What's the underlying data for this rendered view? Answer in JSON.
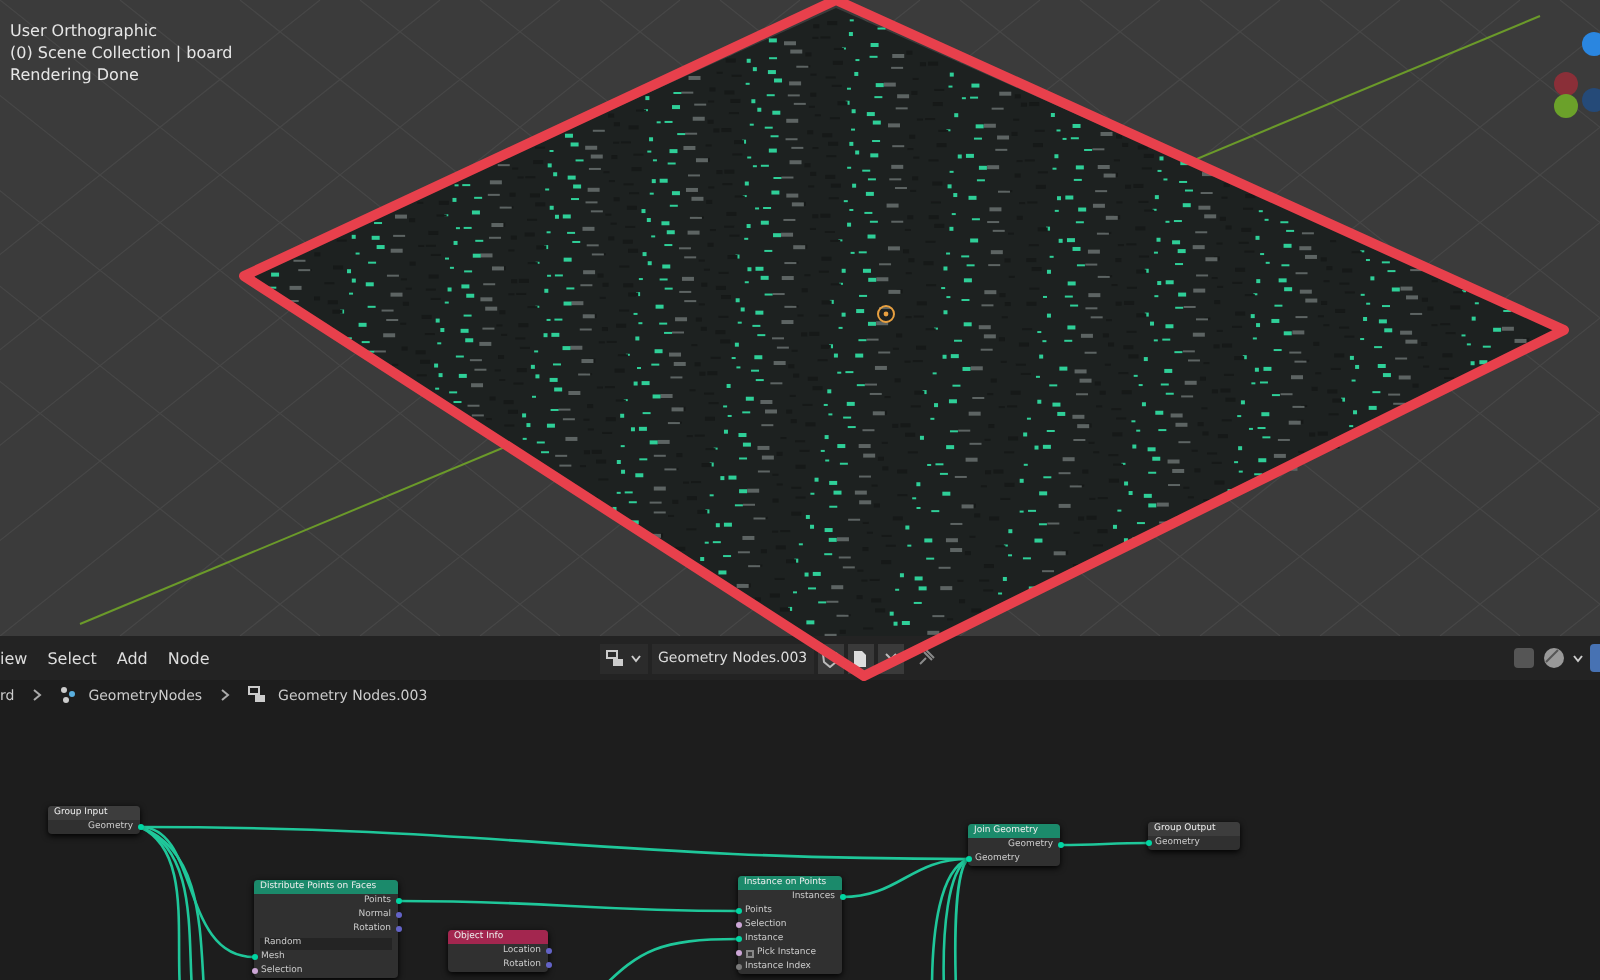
{
  "viewport": {
    "view_name": "User Orthographic",
    "collection": "(0) Scene Collection | board",
    "status": "Rendering Done"
  },
  "node_editor": {
    "menu": [
      "iew",
      "Select",
      "Add",
      "Node"
    ],
    "node_group": "Geometry Nodes.003",
    "breadcrumbs": [
      "rd",
      "GeometryNodes",
      "Geometry Nodes.003"
    ],
    "nodes": [
      {
        "kind": "group",
        "title": "Group Input",
        "rows": [
          {
            "kind": "output",
            "label": "Geometry",
            "color": "#00d6a3"
          }
        ]
      },
      {
        "kind": "geometry",
        "title": "Distribute Points on Faces",
        "rows": [
          {
            "kind": "output",
            "label": "Points",
            "color": "#00d6a3"
          },
          {
            "kind": "output",
            "label": "Normal",
            "color": "#6363c7"
          },
          {
            "kind": "output",
            "label": "Rotation",
            "color": "#6363c7"
          },
          {
            "kind": "dropdown",
            "label": "Random"
          },
          {
            "kind": "input",
            "label": "Mesh",
            "color": "#00d6a3"
          },
          {
            "kind": "input",
            "label": "Selection",
            "color": "#cca6d6"
          }
        ]
      },
      {
        "kind": "input",
        "title": "Object Info",
        "rows": [
          {
            "kind": "output",
            "label": "Location",
            "color": "#6363c7"
          },
          {
            "kind": "output",
            "label": "Rotation",
            "color": "#6363c7"
          }
        ]
      },
      {
        "kind": "geometry",
        "title": "Instance on Points",
        "rows": [
          {
            "kind": "output",
            "label": "Instances",
            "color": "#00d6a3"
          },
          {
            "kind": "input",
            "label": "Points",
            "color": "#00d6a3"
          },
          {
            "kind": "input",
            "label": "Selection",
            "color": "#cca6d6"
          },
          {
            "kind": "input",
            "label": "Instance",
            "color": "#00d6a3"
          },
          {
            "kind": "checkbox",
            "label": "Pick Instance",
            "color": "#cca6d6",
            "checked": false
          },
          {
            "kind": "input",
            "label": "Instance Index",
            "color": "#7a7a7a"
          }
        ]
      },
      {
        "kind": "geometry",
        "title": "Join Geometry",
        "rows": [
          {
            "kind": "output",
            "label": "Geometry",
            "color": "#00d6a3"
          },
          {
            "kind": "input",
            "label": "Geometry",
            "color": "#00d6a3"
          }
        ]
      },
      {
        "kind": "group",
        "title": "Group Output",
        "rows": [
          {
            "kind": "input",
            "label": "Geometry",
            "color": "#00d6a3"
          }
        ]
      }
    ]
  }
}
